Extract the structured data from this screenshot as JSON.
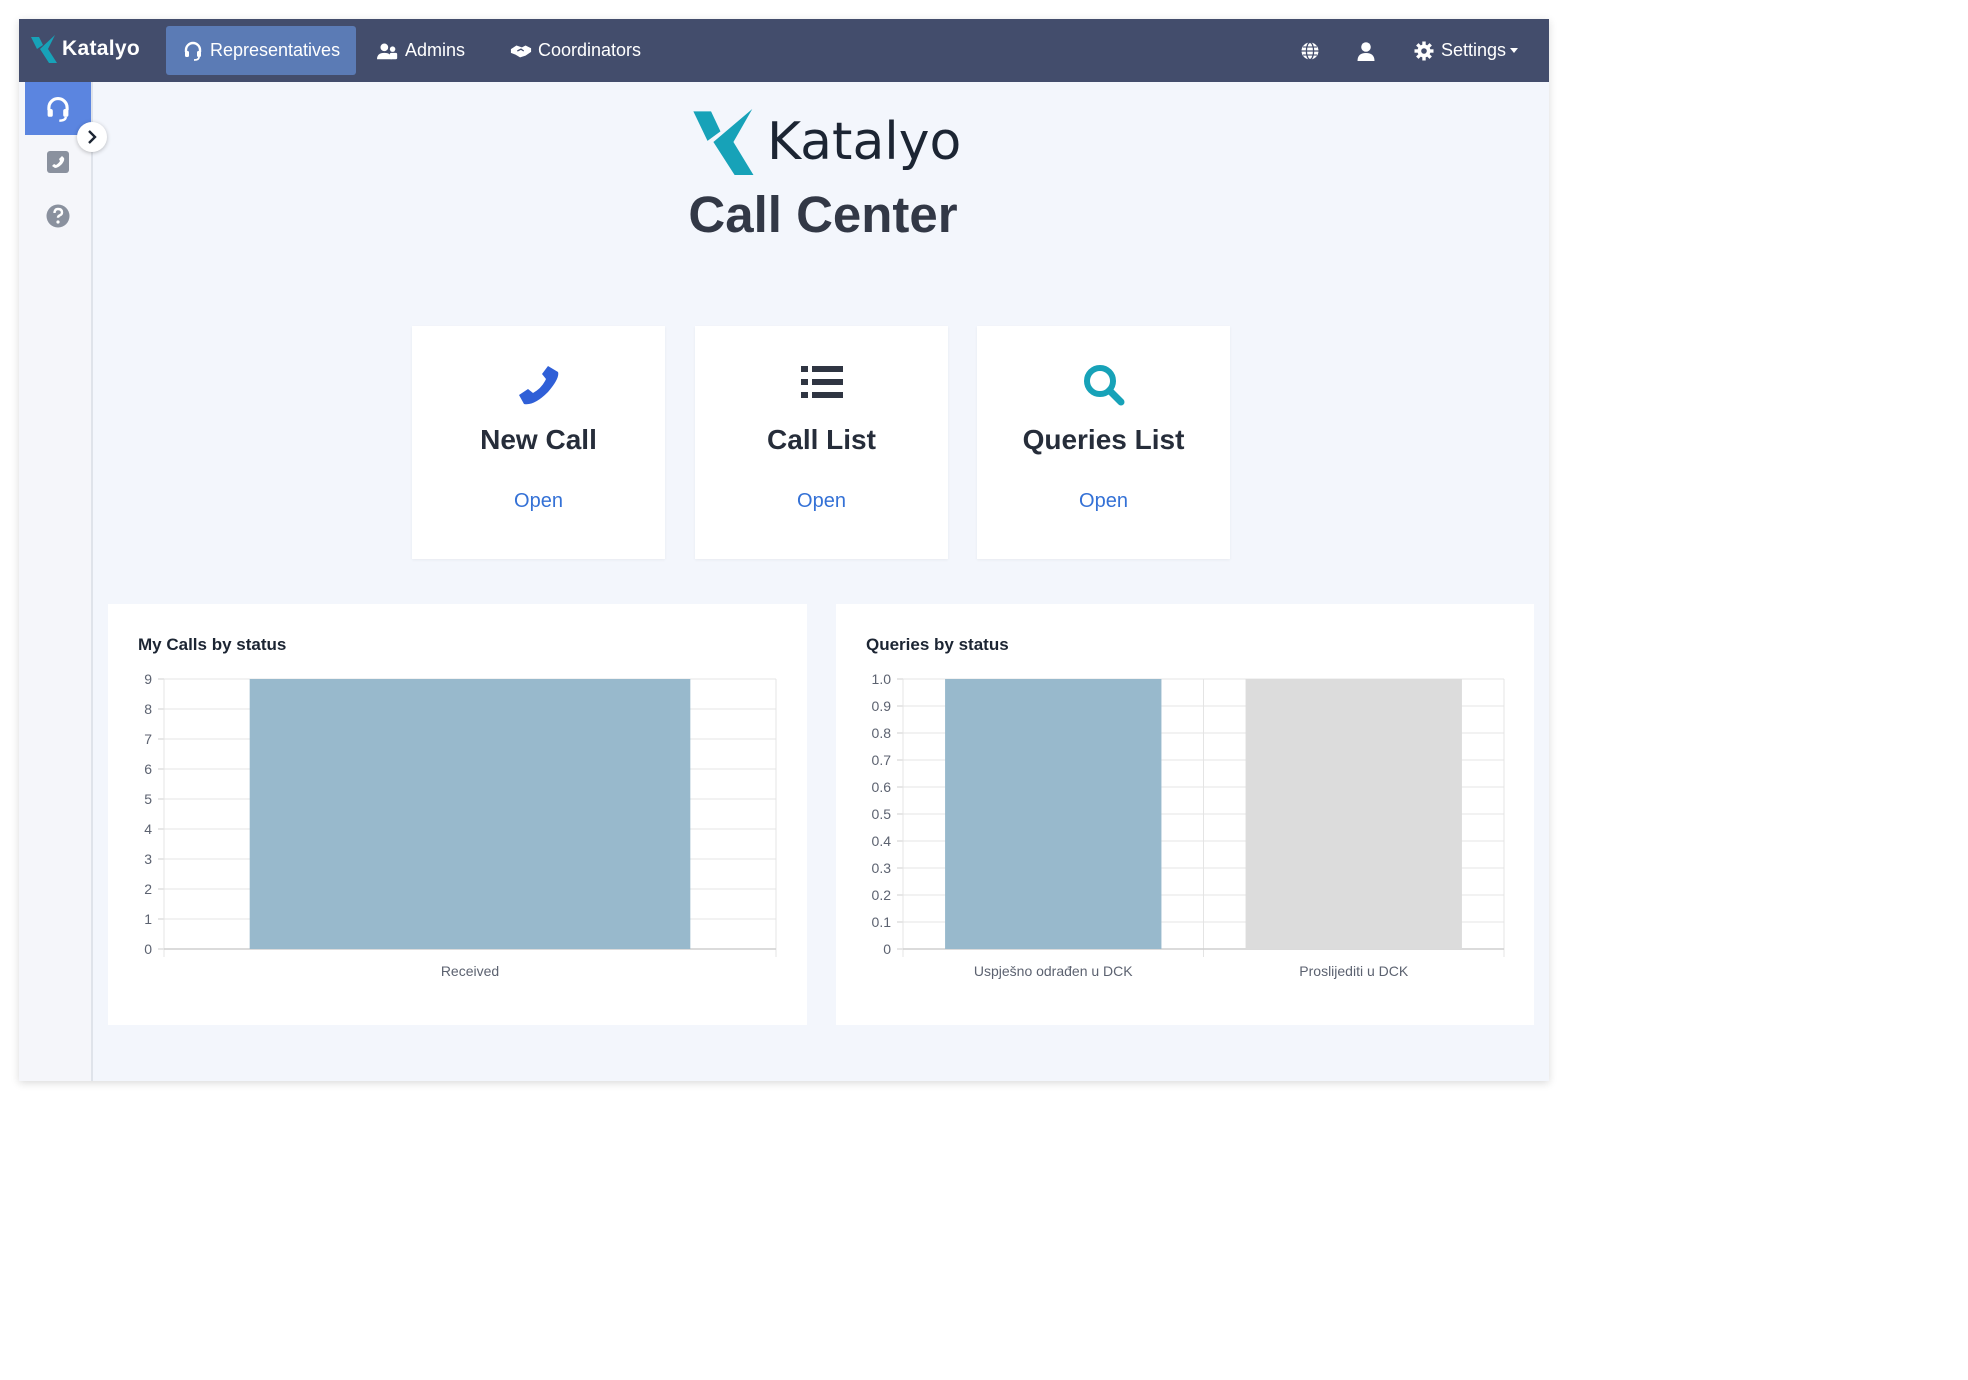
{
  "navbar": {
    "brand": "Katalyo",
    "items": [
      {
        "label": "Representatives",
        "icon": "headset-icon",
        "active": true
      },
      {
        "label": "Admins",
        "icon": "users-icon",
        "active": false
      },
      {
        "label": "Coordinators",
        "icon": "handshake-icon",
        "active": false
      }
    ],
    "right": {
      "language_icon": "globe-icon",
      "user_icon": "user-icon",
      "settings_label": "Settings",
      "settings_icon": "gear-icon"
    }
  },
  "sidebar": {
    "items": [
      {
        "icon": "headset-icon",
        "active": true
      },
      {
        "icon": "phone-square-icon",
        "active": false
      },
      {
        "icon": "question-circle-icon",
        "active": false
      }
    ],
    "toggle_icon": "chevron-right-icon"
  },
  "hero": {
    "logo_text": "Katalyo",
    "title": "Call Center"
  },
  "cards": [
    {
      "title": "New Call",
      "link": "Open",
      "icon": "phone-icon",
      "icon_color": "#2f5fd7"
    },
    {
      "title": "Call List",
      "link": "Open",
      "icon": "list-icon",
      "icon_color": "#2f3542"
    },
    {
      "title": "Queries List",
      "link": "Open",
      "icon": "search-icon",
      "icon_color": "#17a2b8"
    }
  ],
  "colors": {
    "navbar": "#434d6c",
    "nav_active": "#5b7bb5",
    "sidebar_active": "#5b85e0",
    "link": "#3471d6",
    "bar_primary": "#98b9cc",
    "bar_secondary": "#dcdcdc",
    "logo_teal": "#17a2b8",
    "logo_dark": "#1c2533"
  },
  "chart_data": [
    {
      "type": "bar",
      "title": "My Calls by status",
      "categories": [
        "Received"
      ],
      "values": [
        9
      ],
      "colors": [
        "#98b9cc"
      ],
      "ylim": [
        0,
        9
      ],
      "yticks": [
        "0",
        "1",
        "2",
        "3",
        "4",
        "5",
        "6",
        "7",
        "8",
        "9"
      ],
      "grid": true,
      "legend": "none"
    },
    {
      "type": "bar",
      "title": "Queries by status",
      "categories": [
        "Uspješno odrađen u DCK",
        "Proslijediti u DCK"
      ],
      "values": [
        1.0,
        1.0
      ],
      "colors": [
        "#98b9cc",
        "#dcdcdc"
      ],
      "ylim": [
        0,
        1
      ],
      "yticks": [
        "0",
        "0.1",
        "0.2",
        "0.3",
        "0.4",
        "0.5",
        "0.6",
        "0.7",
        "0.8",
        "0.9",
        "1.0"
      ],
      "grid": true,
      "legend": "none"
    }
  ]
}
